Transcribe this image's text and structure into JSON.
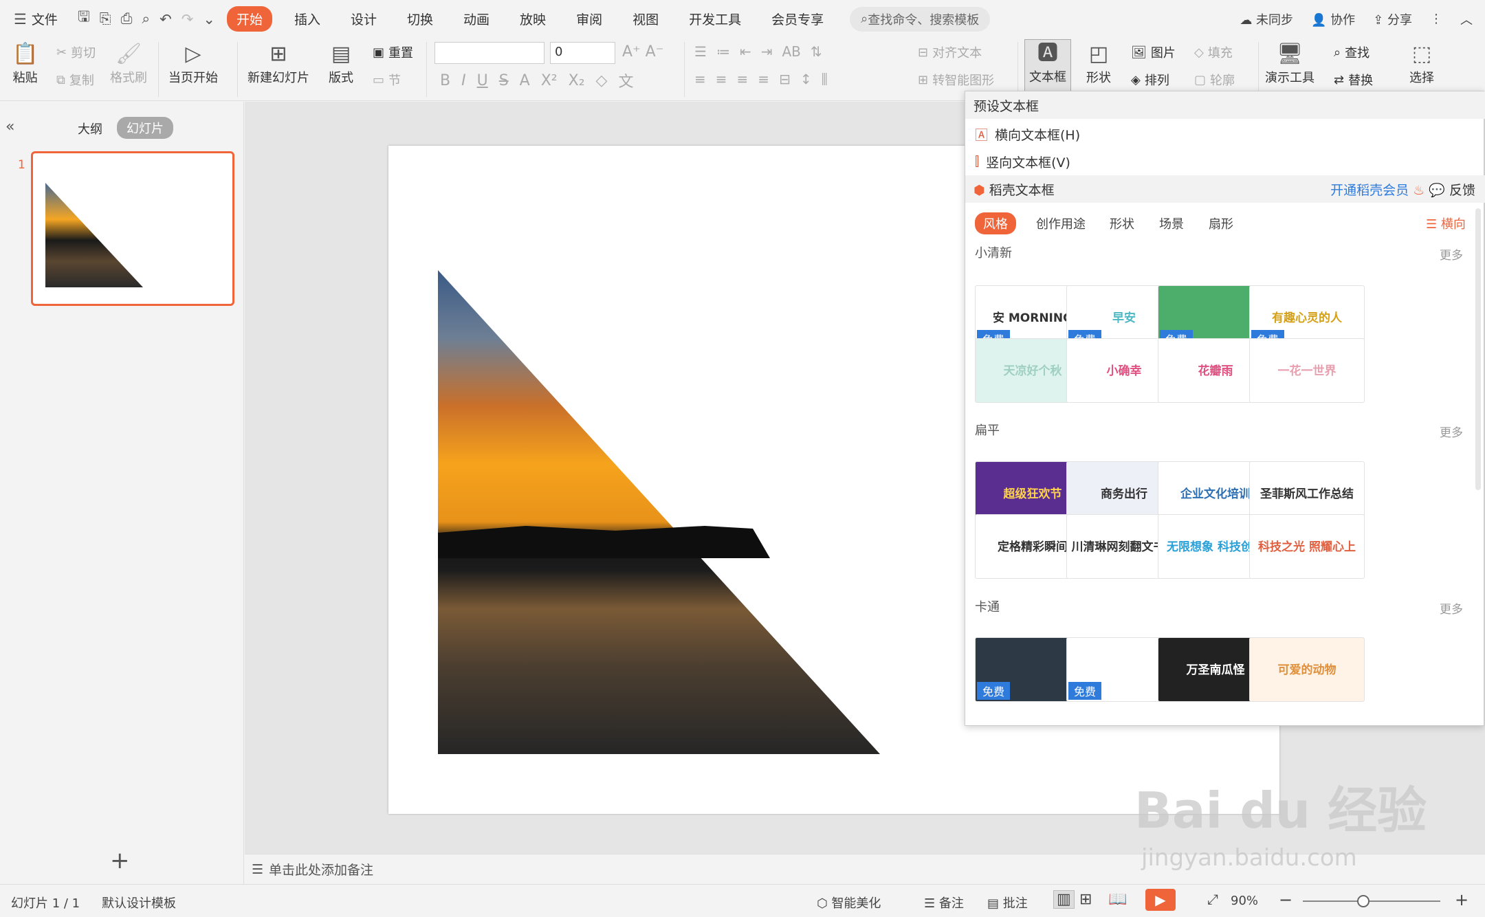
{
  "menu": {
    "file": "文件",
    "tabs": [
      "开始",
      "插入",
      "设计",
      "切换",
      "动画",
      "放映",
      "审阅",
      "视图",
      "开发工具",
      "会员专享"
    ],
    "search_placeholder": "查找命令、搜索模板",
    "right": [
      "未同步",
      "协作",
      "分享"
    ]
  },
  "ribbon": {
    "paste": "粘贴",
    "cut": "剪切",
    "copy": "复制",
    "format_painter": "格式刷",
    "from_current": "当页开始",
    "new_slide": "新建幻灯片",
    "layout": "版式",
    "reset": "重置",
    "section": "节",
    "font_size": "0",
    "align_text": "对齐文本",
    "smart_art": "转智能图形",
    "textbox": "文本框",
    "shape": "形状",
    "picture": "图片",
    "arrange": "排列",
    "fill": "填充",
    "outline": "轮廓",
    "presenter": "演示工具",
    "find": "查找",
    "replace": "替换",
    "select": "选择"
  },
  "left": {
    "outline_tab": "大纲",
    "slides_tab": "幻灯片",
    "slide_number": "1"
  },
  "notes_placeholder": "单击此处添加备注",
  "status": {
    "slide_info": "幻灯片 1 / 1",
    "template": "默认设计模板",
    "beautify": "智能美化",
    "notes": "备注",
    "comments": "批注",
    "zoom": "90%"
  },
  "dropdown": {
    "preset_header": "预设文本框",
    "horizontal": "横向文本框(H)",
    "vertical": "竖向文本框(V)",
    "daoke": "稻壳文本框",
    "vip": "开通稻壳会员",
    "feedback": "反馈",
    "tabs": [
      "风格",
      "创作用途",
      "形状",
      "场景",
      "扇形"
    ],
    "orientation": "横向",
    "more": "更多",
    "free": "免费",
    "sections": [
      {
        "title": "小清新",
        "cards": [
          "安 MORNING",
          "早安",
          "",
          "有趣心灵的人",
          "天凉好个秋",
          "小确幸",
          "花瓣雨",
          "一花一世界"
        ]
      },
      {
        "title": "扁平",
        "cards": [
          "超级狂欢节",
          "商务出行",
          "企业文化培训",
          "圣菲斯风工作总结",
          "定格精彩瞬间",
          "川清琳网刻翻文书照",
          "无限想象 科技创造",
          "科技之光 照耀心上"
        ]
      },
      {
        "title": "卡通",
        "cards": [
          "",
          "",
          "万圣南瓜怪",
          "可爱的动物"
        ]
      }
    ]
  },
  "watermark": {
    "brand": "Bai du 经验",
    "url": "jingyan.baidu.com"
  },
  "colors": {
    "accent": "#f0643a",
    "free_badge": "#2f7bdc"
  }
}
